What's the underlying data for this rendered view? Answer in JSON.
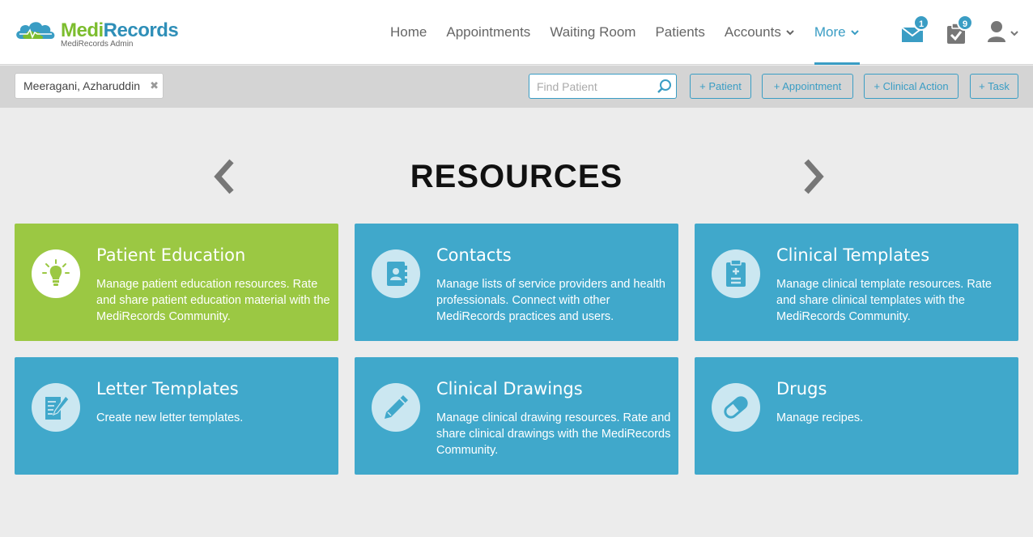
{
  "brand": {
    "name_part1": "Medi",
    "name_part2": "Records",
    "subtitle": "MediRecords Admin"
  },
  "nav": {
    "items": [
      {
        "label": "Home"
      },
      {
        "label": "Appointments"
      },
      {
        "label": "Waiting Room"
      },
      {
        "label": "Patients"
      },
      {
        "label": "Accounts"
      },
      {
        "label": "More"
      }
    ],
    "active": "More",
    "mail_count": "1",
    "tasks_count": "9"
  },
  "subbar": {
    "patient_name": "Meeragani, Azharuddin",
    "search_placeholder": "Find Patient",
    "buttons": {
      "patient": "+ Patient",
      "appointment": "+ Appointment",
      "clinical_action": "+ Clinical Action",
      "task": "+ Task"
    }
  },
  "page": {
    "title": "RESOURCES"
  },
  "cards": [
    {
      "title": "Patient Education",
      "desc": "Manage patient education resources. Rate and share patient education material with the MediRecords Community.",
      "icon": "lightbulb-icon"
    },
    {
      "title": "Contacts",
      "desc": "Manage lists of service providers and health professionals. Connect with other MediRecords practices and users.",
      "icon": "address-book-icon"
    },
    {
      "title": "Clinical Templates",
      "desc": "Manage clinical template resources. Rate and share clinical templates with the MediRecords Community.",
      "icon": "clipboard-icon"
    },
    {
      "title": "Letter Templates",
      "desc": "Create new letter templates.",
      "icon": "letter-edit-icon"
    },
    {
      "title": "Clinical Drawings",
      "desc": "Manage clinical drawing resources. Rate and share clinical drawings with the MediRecords Community.",
      "icon": "pencil-icon"
    },
    {
      "title": "Drugs",
      "desc": "Manage recipes.",
      "icon": "pill-icon"
    }
  ],
  "colors": {
    "accent": "#3a9dc4",
    "card_blue": "#40a8cb",
    "card_green": "#9bc843",
    "brand_green": "#7cbd2e",
    "brand_blue": "#2f8fb8"
  }
}
